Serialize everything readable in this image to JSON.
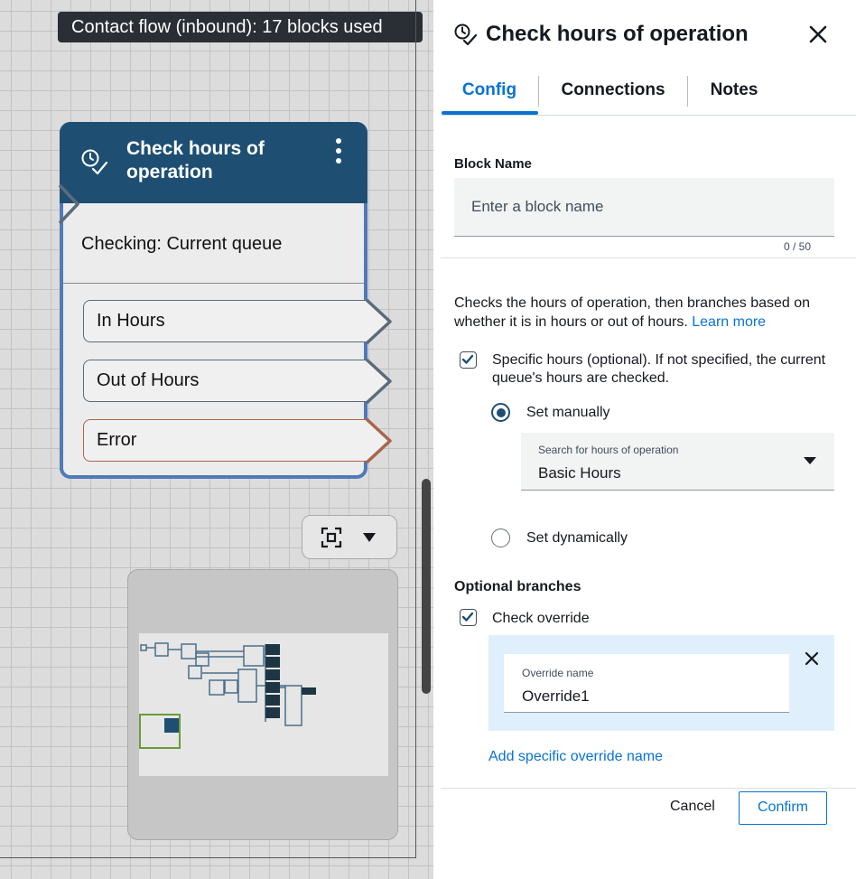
{
  "canvas": {
    "tooltip": "Contact flow (inbound): 17 blocks used",
    "block": {
      "title": "Check hours of operation",
      "checking": "Checking: Current queue",
      "branches": [
        "In Hours",
        "Out of Hours",
        "Error"
      ]
    }
  },
  "panel": {
    "title": "Check hours of operation",
    "tabs": [
      "Config",
      "Connections",
      "Notes"
    ],
    "active_tab": "Config",
    "block_name": {
      "label": "Block Name",
      "placeholder": "Enter a block name",
      "char_count": "0 / 50"
    },
    "description": "Checks the hours of operation, then branches based on whether it is in hours or out of hours.",
    "learn_more": "Learn more",
    "specific_hours": {
      "label": "Specific hours (optional). If not specified, the current queue's hours are checked.",
      "checked": true
    },
    "set_manually": {
      "label": "Set manually",
      "selected": true
    },
    "hours_select": {
      "label": "Search for hours of operation",
      "value": "Basic Hours"
    },
    "set_dynamically": {
      "label": "Set dynamically",
      "selected": false
    },
    "optional_branches": {
      "heading": "Optional branches",
      "check_override": {
        "label": "Check override",
        "checked": true
      },
      "override_name": {
        "label": "Override name",
        "value": "Override1"
      },
      "add_link": "Add specific override name"
    },
    "footer": {
      "cancel": "Cancel",
      "confirm": "Confirm"
    }
  },
  "colors": {
    "block_header": "#1e4f73",
    "block_border": "#4f7ab8",
    "accent": "#0972d3",
    "override_bg": "#dff0fc"
  }
}
